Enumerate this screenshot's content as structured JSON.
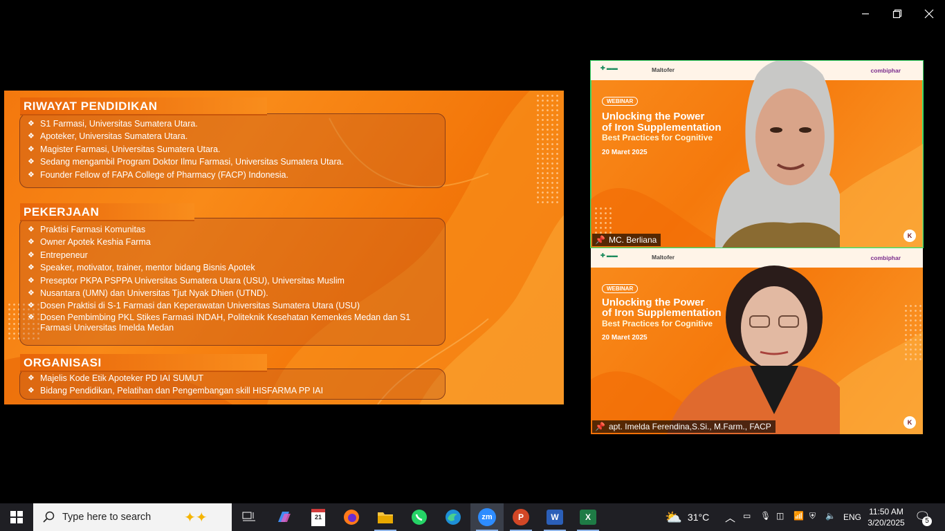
{
  "slide": {
    "sections": [
      {
        "title": "RIWAYAT PENDIDIKAN",
        "items": [
          "S1 Farmasi, Universitas Sumatera Utara.",
          "Apoteker, Universitas Sumatera Utara.",
          "Magister Farmasi, Universitas Sumatera Utara.",
          "Sedang mengambil Program Doktor Ilmu Farmasi, Universitas Sumatera Utara.",
          "Founder Fellow of FAPA College of Pharmacy (FACP) Indonesia."
        ]
      },
      {
        "title": "PEKERJAAN",
        "items": [
          "Praktisi Farmasi Komunitas",
          "Owner Apotek Keshia Farma",
          "Entrepeneur",
          "Speaker, motivator, trainer, mentor bidang Bisnis Apotek",
          "Preseptor PKPA PSPPA Universitas Sumatera Utara (USU), Universitas Muslim",
          "Nusantara (UMN) dan Universitas Tjut Nyak Dhien (UTND).",
          "Dosen Praktisi di S-1 Farmasi dan Keperawatan Universitas Sumatera Utara (USU)",
          "Dosen Pembimbing PKL Stikes Farmasi INDAH, Politeknik Kesehatan Kemenkes Medan dan S1 Farmasi Universitas Imelda Medan"
        ]
      },
      {
        "title": "ORGANISASI",
        "items": [
          "Majelis Kode Etik Apoteker PD IAI SUMUT",
          "Bidang Pendidikan, Pelatihan dan Pengembangan skill HISFARMA PP IAI"
        ]
      }
    ]
  },
  "participants": [
    {
      "name": "MC. Berliana",
      "badge": "WEBINAR",
      "heading1": "Unlocking the Power",
      "heading2": "of Iron Supplementation",
      "subheading": "Best Practices for Cognitive",
      "date": "20 Maret 2025",
      "brand_left": "Maltofer",
      "brand_right": "combiphar",
      "active_speaker": true
    },
    {
      "name": "apt. Imelda Ferendina,S.Si., M.Farm., FACP",
      "badge": "WEBINAR",
      "heading1": "Unlocking the Power",
      "heading2": "of Iron Supplementation",
      "subheading": "Best Practices for Cognitive",
      "date": "20 Maret 2025",
      "brand_left": "Maltofer",
      "brand_right": "combiphar",
      "active_speaker": false
    }
  ],
  "taskbar": {
    "search_placeholder": "Type here to search",
    "apps": [
      "task-view",
      "copilot",
      "calendar-app",
      "firefox",
      "file-explorer",
      "whatsapp",
      "edge",
      "zoom",
      "powerpoint",
      "word",
      "excel"
    ],
    "weather": "31°C",
    "language": "ENG",
    "time": "11:50 AM",
    "date": "3/20/2025",
    "notification_count": "5"
  },
  "colors": {
    "slide_orange": "#f5790c",
    "active_border": "#3ddc6a",
    "taskbar_bg": "#1f1f24"
  }
}
